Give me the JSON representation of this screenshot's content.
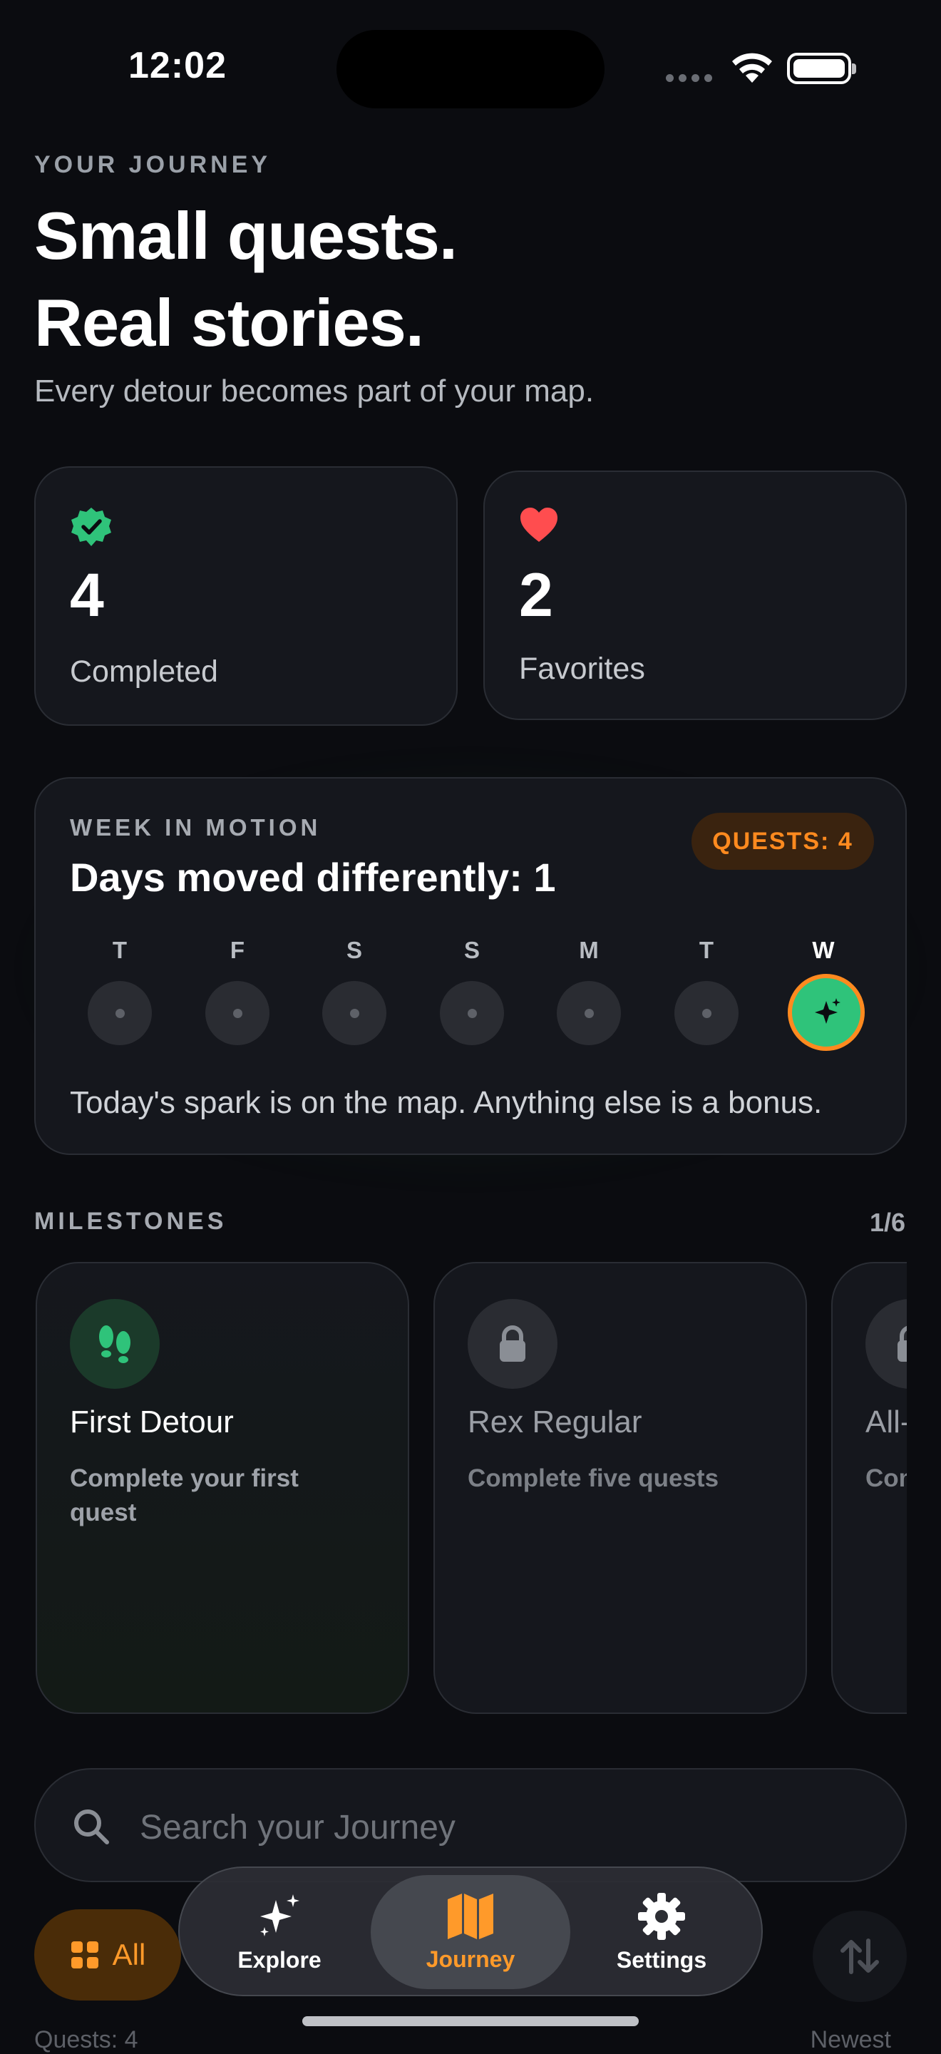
{
  "status_bar": {
    "time": "12:02"
  },
  "header": {
    "eyebrow": "YOUR JOURNEY",
    "title_line1": "Small quests.",
    "title_line2": "Real stories.",
    "subtitle": "Every detour becomes part of your map."
  },
  "stats": [
    {
      "icon": "verified-badge-icon",
      "value": "4",
      "label": "Completed",
      "color": "#2fc37a"
    },
    {
      "icon": "heart-icon",
      "value": "2",
      "label": "Favorites",
      "color": "#ff4d4f"
    }
  ],
  "week": {
    "eyebrow": "WEEK IN MOTION",
    "title": "Days moved differently: 1",
    "badge": "QUESTS: 4",
    "days": [
      {
        "label": "T",
        "active": false
      },
      {
        "label": "F",
        "active": false
      },
      {
        "label": "S",
        "active": false
      },
      {
        "label": "S",
        "active": false
      },
      {
        "label": "M",
        "active": false
      },
      {
        "label": "T",
        "active": false
      },
      {
        "label": "W",
        "active": true
      }
    ],
    "note": "Today's spark is on the map. Anything else is a bonus."
  },
  "milestones": {
    "heading": "MILESTONES",
    "count": "1/6",
    "items": [
      {
        "title": "First Detour",
        "desc": "Complete your first quest",
        "icon": "footprints-icon",
        "unlocked": true
      },
      {
        "title": "Rex Regular",
        "desc": "Complete five quests",
        "icon": "lock-icon",
        "unlocked": false
      },
      {
        "title": "All-",
        "desc": "Com",
        "icon": "lock-icon",
        "unlocked": false
      }
    ]
  },
  "search": {
    "placeholder": "Search your Journey"
  },
  "filters": {
    "all_label": "All",
    "meta_left": "Quests: 4",
    "meta_right": "Newest"
  },
  "tabs": [
    {
      "label": "Explore",
      "icon": "sparkles-icon",
      "active": false
    },
    {
      "label": "Journey",
      "icon": "map-icon",
      "active": true
    },
    {
      "label": "Settings",
      "icon": "gear-icon",
      "active": false
    }
  ],
  "colors": {
    "accent": "#ff9a2a",
    "success": "#2fc37a",
    "background": "#0b0c10",
    "card": "#15171d"
  }
}
